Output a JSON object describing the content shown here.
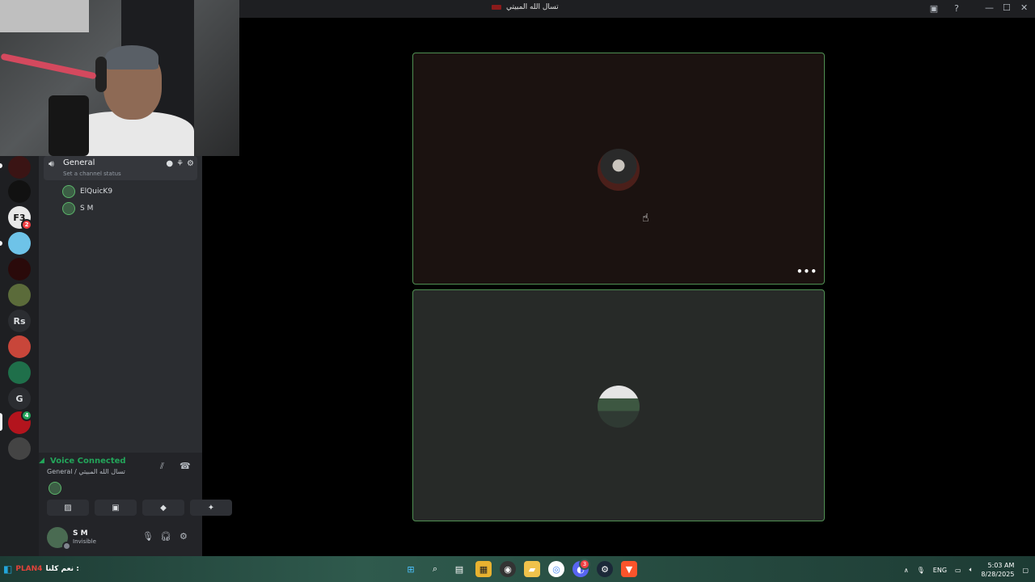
{
  "window": {
    "title": "تسال الله المبيتي",
    "inbox_icon": "inbox-icon",
    "help_icon": "help-icon",
    "minimize": "—",
    "maximize": "☐",
    "close": "✕"
  },
  "servers": [
    {
      "label": "",
      "color": "#3a1414"
    },
    {
      "label": "",
      "color": "#111111"
    },
    {
      "label": "F3",
      "color": "#e8e8e8",
      "badge": "2"
    },
    {
      "label": "",
      "color": "#6ec3e8"
    },
    {
      "label": "",
      "color": "#2a0a0a"
    },
    {
      "label": "",
      "color": "#5b6b3a"
    },
    {
      "label": "Rs",
      "color": "#2b2d31"
    },
    {
      "label": "",
      "color": "#c8463a"
    },
    {
      "label": "",
      "color": "#1f6f4a"
    },
    {
      "label": "G",
      "color": "#2b2d31"
    },
    {
      "label": "",
      "color": "#b3141d",
      "badge": "4"
    },
    {
      "label": "",
      "color": "#444444"
    }
  ],
  "voice_channel": {
    "name": "General",
    "status_placeholder": "Set a channel status"
  },
  "members": [
    "ElQuicK9",
    "S M"
  ],
  "voice_panel": {
    "title": "Voice Connected",
    "subtitle": "General / تسال الله المبيتي"
  },
  "user": {
    "name": "S M",
    "status": "Invisible"
  },
  "taskbar": {
    "streamer_name": "PLAN4",
    "chat_message": "نعم كلنا :",
    "language": "ENG",
    "time": "5:03 AM",
    "date": "8/28/2025",
    "discord_badge": "3"
  }
}
